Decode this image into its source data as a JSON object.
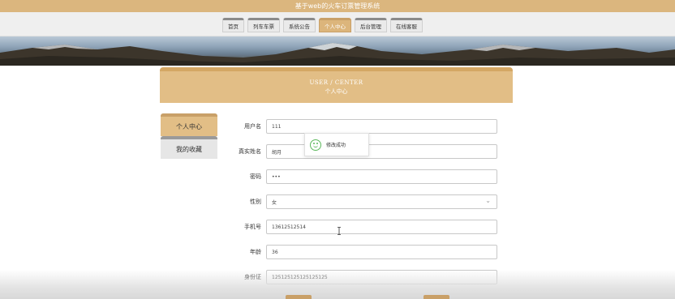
{
  "window": {
    "title": "基于web的火车订票管理系统"
  },
  "nav": {
    "items": [
      {
        "label": "首页",
        "active": false
      },
      {
        "label": "列车车票",
        "active": false
      },
      {
        "label": "系统公告",
        "active": false
      },
      {
        "label": "个人中心",
        "active": true
      },
      {
        "label": "后台管理",
        "active": false
      },
      {
        "label": "在线客服",
        "active": false
      }
    ]
  },
  "center": {
    "title_en": "USER / CENTER",
    "title_cn": "个人中心"
  },
  "side_menu": {
    "items": [
      {
        "label": "个人中心",
        "active": true
      },
      {
        "label": "我的收藏",
        "active": false
      }
    ]
  },
  "form": {
    "username": {
      "label": "用户名",
      "value": "111"
    },
    "realname": {
      "label": "真实姓名",
      "value": "胡月"
    },
    "password": {
      "label": "密码",
      "value": "•••"
    },
    "gender": {
      "label": "性别",
      "value": "女"
    },
    "phone": {
      "label": "手机号",
      "value": "13612512514"
    },
    "age": {
      "label": "年龄",
      "value": "36"
    },
    "idcard": {
      "label": "身份证",
      "value": "125125125125125125"
    }
  },
  "toast": {
    "message": "修改成功",
    "icon": "smile-icon",
    "color": "#5cb85c"
  },
  "colors": {
    "accent": "#dcb57b",
    "header_bar": "#dbb67e"
  }
}
